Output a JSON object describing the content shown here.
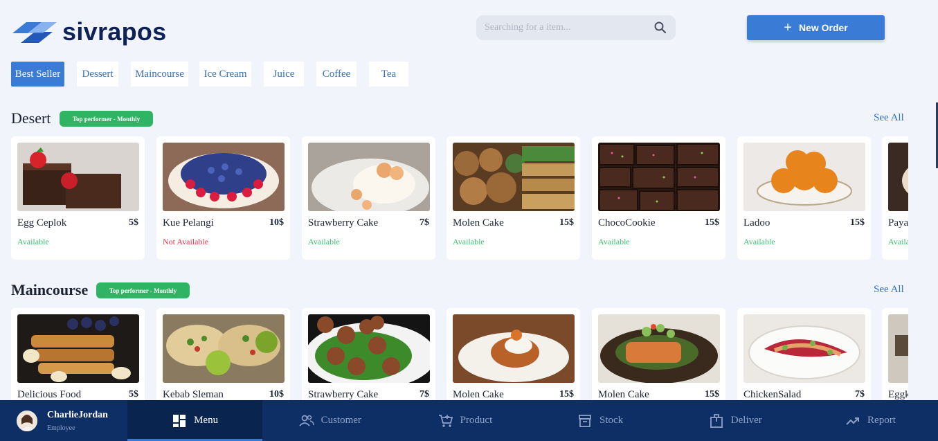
{
  "brand": {
    "name": "sivrapos"
  },
  "search": {
    "placeholder": "Searching for a item..."
  },
  "new_order": {
    "label": "New Order"
  },
  "categories": [
    "Best Seller",
    "Dessert",
    "Maincourse",
    "Ice Cream",
    "Juice",
    "Coffee",
    "Tea"
  ],
  "sections": [
    {
      "title": "Desert",
      "badge": "Top performer - Monthly",
      "see_all": "See All",
      "items": [
        {
          "name": "Egg Ceplok",
          "price": "5$",
          "status": "Available"
        },
        {
          "name": "Kue Pelangi",
          "price": "10$",
          "status": "Not Available"
        },
        {
          "name": "Strawberry Cake",
          "price": "7$",
          "status": "Available"
        },
        {
          "name": "Molen Cake",
          "price": "15$",
          "status": "Available"
        },
        {
          "name": "ChocoCookie",
          "price": "15$",
          "status": "Available"
        },
        {
          "name": "Ladoo",
          "price": "15$",
          "status": "Available"
        },
        {
          "name": "Paya",
          "price": "",
          "status": "Availa"
        }
      ]
    },
    {
      "title": "Maincourse",
      "badge": "Top performer - Monthly",
      "see_all": "See All",
      "items": [
        {
          "name": "Delicious Food",
          "price": "5$",
          "status": ""
        },
        {
          "name": "Kebab Sleman",
          "price": "10$",
          "status": ""
        },
        {
          "name": "Strawberry Cake",
          "price": "7$",
          "status": ""
        },
        {
          "name": "Molen Cake",
          "price": "15$",
          "status": ""
        },
        {
          "name": "Molen Cake",
          "price": "15$",
          "status": ""
        },
        {
          "name": "ChickenSalad",
          "price": "7$",
          "status": ""
        },
        {
          "name": "Eggk",
          "price": "",
          "status": ""
        }
      ]
    }
  ],
  "user": {
    "name": "CharlieJordan",
    "role": "Employee"
  },
  "nav": [
    "Menu",
    "Customer",
    "Product",
    "Stock",
    "Deliver",
    "Report"
  ],
  "colors": {
    "accent": "#3a7bd5",
    "navy": "#0d2f66",
    "available": "#3fbf74",
    "not_available": "#e2374a",
    "badge": "#2fb463"
  }
}
